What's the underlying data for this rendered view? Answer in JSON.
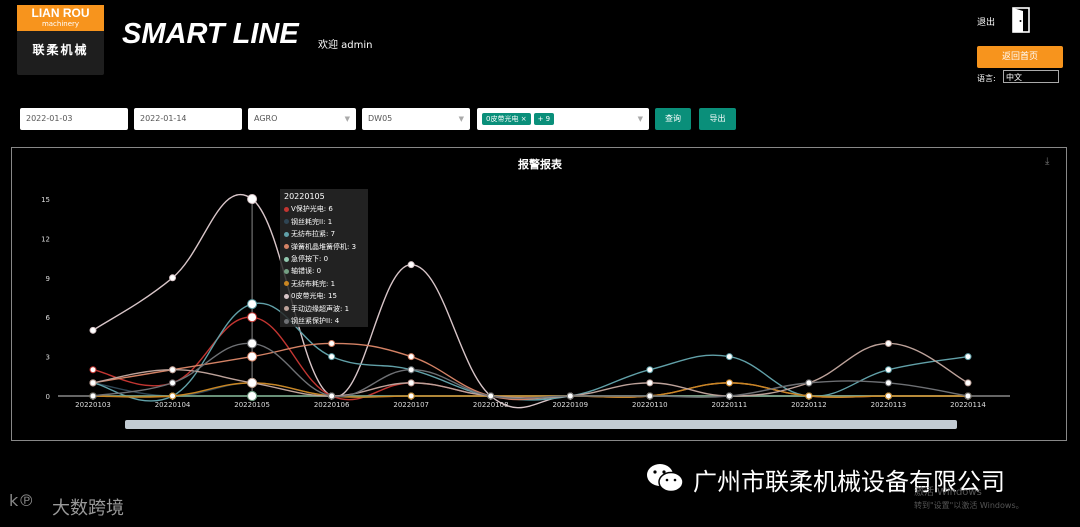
{
  "header": {
    "logo_line1": "LIAN ROU",
    "logo_line2": "machinery",
    "logo_cn": "联柔机械",
    "title": "SMART LINE",
    "welcome": "欢迎 admin",
    "logout_label": "退出",
    "home_button": "返回首页",
    "lang_label": "语言:",
    "lang_value": "中文"
  },
  "filters": {
    "start_date": "2022-01-03",
    "end_date": "2022-01-14",
    "product": "AGRO",
    "line": "DW05",
    "tag1": "0皮带光电",
    "tag_more": "+ 9",
    "query_button": "查询",
    "export_button": "导出"
  },
  "chart_data": {
    "type": "line",
    "title": "报警报表",
    "x": [
      "20220103",
      "20220104",
      "20220105",
      "20220106",
      "20220107",
      "20220108",
      "20220109",
      "20220110",
      "20220111",
      "20220112",
      "20220113",
      "20220114"
    ],
    "yticks": [
      0,
      3,
      6,
      9,
      12,
      15
    ],
    "ylim": [
      0,
      15
    ],
    "series": [
      {
        "name": "0皮带光电",
        "color": "#d8c5c8",
        "values": [
          5,
          9,
          15,
          0,
          10,
          0,
          0,
          0,
          0,
          0,
          0,
          0
        ]
      },
      {
        "name": "V保护光电",
        "color": "#c23531",
        "values": [
          2,
          1,
          6,
          0,
          1,
          0,
          0,
          0,
          0,
          0,
          0,
          0
        ]
      },
      {
        "name": "钢丝耗完II",
        "color": "#2f4554",
        "values": [
          1,
          0,
          1,
          0,
          0,
          0,
          0,
          0,
          0,
          0,
          0,
          0
        ]
      },
      {
        "name": "无纺布拉紧",
        "color": "#61a0a8",
        "values": [
          1,
          0,
          7,
          3,
          2,
          0,
          0,
          2,
          3,
          0,
          2,
          3
        ]
      },
      {
        "name": "弹簧机晶堆簧停机",
        "color": "#d48265",
        "values": [
          1,
          2,
          3,
          4,
          3,
          0,
          0,
          0,
          1,
          0,
          0,
          0
        ]
      },
      {
        "name": "急停按下",
        "color": "#91c7ae",
        "values": [
          0,
          0,
          0,
          0,
          0,
          0,
          0,
          0,
          0,
          0,
          0,
          0
        ]
      },
      {
        "name": "轴错误",
        "color": "#749f83",
        "values": [
          0,
          0,
          0,
          0,
          0,
          0,
          0,
          0,
          0,
          0,
          0,
          0
        ]
      },
      {
        "name": "无纺布耗完",
        "color": "#ca8622",
        "values": [
          0,
          0,
          1,
          0,
          0,
          0,
          0,
          0,
          1,
          0,
          0,
          0
        ]
      },
      {
        "name": "手动边缘超声波",
        "color": "#bda29a",
        "values": [
          1,
          2,
          1,
          0,
          1,
          0,
          0,
          1,
          0,
          1,
          4,
          1
        ]
      },
      {
        "name": "钢丝紧保护II",
        "color": "#6e7074",
        "values": [
          0,
          1,
          4,
          0,
          2,
          0,
          0,
          0,
          0,
          1,
          1,
          0
        ]
      }
    ],
    "tooltip": {
      "title": "20220105",
      "rows": [
        {
          "label": "V保护光电: 6",
          "color": "#c23531"
        },
        {
          "label": "钢丝耗完II: 1",
          "color": "#2f4554"
        },
        {
          "label": "无纺布拉紧: 7",
          "color": "#61a0a8"
        },
        {
          "label": "弹簧机晶堆簧停机: 3",
          "color": "#d48265"
        },
        {
          "label": "急停按下: 0",
          "color": "#91c7ae"
        },
        {
          "label": "轴错误: 0",
          "color": "#749f83"
        },
        {
          "label": "无纺布耗完: 1",
          "color": "#ca8622"
        },
        {
          "label": "0皮带光电: 15",
          "color": "#d8c5c8"
        },
        {
          "label": "手动边缘超声波: 1",
          "color": "#bda29a"
        },
        {
          "label": "钢丝紧保护II: 4",
          "color": "#6e7074"
        }
      ]
    }
  },
  "footer": {
    "company": "广州市联柔机械设备有限公司",
    "watermark_text": "大数跨境",
    "activate_line1": "激活 Windows",
    "activate_line2": "转到\"设置\"以激活 Windows。"
  }
}
